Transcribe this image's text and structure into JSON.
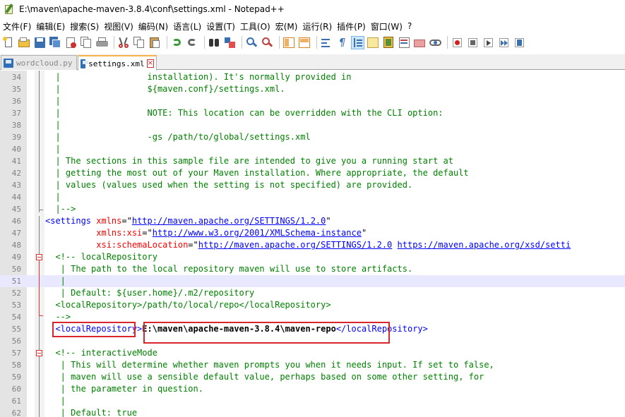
{
  "window": {
    "title": "E:\\maven\\apache-maven-3.8.4\\conf\\settings.xml - Notepad++"
  },
  "menu": [
    "文件(F)",
    "编辑(E)",
    "搜索(S)",
    "视图(V)",
    "编码(N)",
    "语言(L)",
    "设置(T)",
    "工具(O)",
    "宏(M)",
    "运行(R)",
    "插件(P)",
    "窗口(W)",
    "?"
  ],
  "tabs": [
    {
      "label": "wordcloud.py",
      "active": false
    },
    {
      "label": "settings.xml",
      "active": true
    }
  ],
  "editor": {
    "current_line": "51",
    "lines": [
      {
        "no": "34",
        "text": "  |                 installation). It's normally provided in"
      },
      {
        "no": "35",
        "text": "  |                 ${maven.conf}/settings.xml."
      },
      {
        "no": "36",
        "text": "  |"
      },
      {
        "no": "37",
        "text": "  |                 NOTE: This location can be overridden with the CLI option:"
      },
      {
        "no": "38",
        "text": "  |"
      },
      {
        "no": "39",
        "text": "  |                 -gs /path/to/global/settings.xml"
      },
      {
        "no": "40",
        "text": "  |"
      },
      {
        "no": "41",
        "text": "  | The sections in this sample file are intended to give you a running start at"
      },
      {
        "no": "42",
        "text": "  | getting the most out of your Maven installation. Where appropriate, the default"
      },
      {
        "no": "43",
        "text": "  | values (values used when the setting is not specified) are provided."
      },
      {
        "no": "44",
        "text": "  |"
      },
      {
        "no": "45",
        "text": "  |-->"
      },
      {
        "no": "46",
        "open": "<settings",
        "attr": " xmlns",
        "eq": "=\"",
        "url": "http://maven.apache.org/SETTINGS/1.2.0",
        "close": "\""
      },
      {
        "no": "47",
        "indent": "          ",
        "attr": "xmlns:xsi",
        "eq": "=\"",
        "url": "http://www.w3.org/2001/XMLSchema-instance",
        "close": "\""
      },
      {
        "no": "48",
        "indent": "          ",
        "attr": "xsi:schemaLocation",
        "eq": "=\"",
        "url": "http://maven.apache.org/SETTINGS/1.2.0",
        "sp": " ",
        "url2": "https://maven.apache.org/xsd/setti"
      },
      {
        "no": "49",
        "text": "  <!-- localRepository"
      },
      {
        "no": "50",
        "text": "   | The path to the local repository maven will use to store artifacts."
      },
      {
        "no": "51",
        "text": "   |"
      },
      {
        "no": "52",
        "text": "   | Default: ${user.home}/.m2/repository"
      },
      {
        "no": "53",
        "text": "  <localRepository>/path/to/local/repo</localRepository>"
      },
      {
        "no": "54",
        "text": "  -->"
      },
      {
        "no": "55",
        "indent": "  ",
        "open": "<localRepository>",
        "value": "E:\\maven\\apache-maven-3.8.4\\maven-repo",
        "close": "</localRepository>"
      },
      {
        "no": "56",
        "text": ""
      },
      {
        "no": "57",
        "text": "  <!-- interactiveMode"
      },
      {
        "no": "58",
        "text": "   | This will determine whether maven prompts you when it needs input. If set to false,"
      },
      {
        "no": "59",
        "text": "   | maven will use a sensible default value, perhaps based on some other setting, for"
      },
      {
        "no": "60",
        "text": "   | the parameter in question."
      },
      {
        "no": "61",
        "text": "   |"
      },
      {
        "no": "62",
        "text": "   | Default: true"
      }
    ]
  },
  "colors": {
    "comment": "#008000",
    "tag": "#0000ff",
    "attribute": "#ff0000",
    "highlight_box": "#d9262d",
    "current_line": "#e8e8ff"
  }
}
